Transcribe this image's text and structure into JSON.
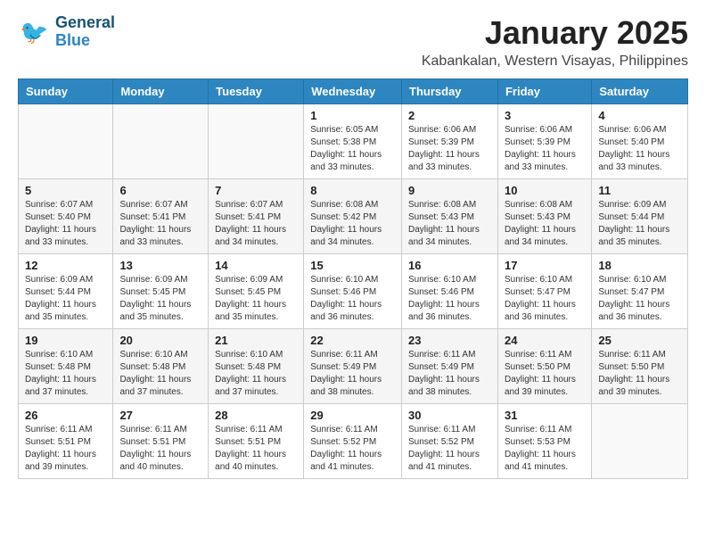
{
  "logo": {
    "general": "General",
    "blue": "Blue"
  },
  "title": "January 2025",
  "location": "Kabankalan, Western Visayas, Philippines",
  "days_header": [
    "Sunday",
    "Monday",
    "Tuesday",
    "Wednesday",
    "Thursday",
    "Friday",
    "Saturday"
  ],
  "weeks": [
    [
      {
        "day": "",
        "info": ""
      },
      {
        "day": "",
        "info": ""
      },
      {
        "day": "",
        "info": ""
      },
      {
        "day": "1",
        "info": "Sunrise: 6:05 AM\nSunset: 5:38 PM\nDaylight: 11 hours\nand 33 minutes."
      },
      {
        "day": "2",
        "info": "Sunrise: 6:06 AM\nSunset: 5:39 PM\nDaylight: 11 hours\nand 33 minutes."
      },
      {
        "day": "3",
        "info": "Sunrise: 6:06 AM\nSunset: 5:39 PM\nDaylight: 11 hours\nand 33 minutes."
      },
      {
        "day": "4",
        "info": "Sunrise: 6:06 AM\nSunset: 5:40 PM\nDaylight: 11 hours\nand 33 minutes."
      }
    ],
    [
      {
        "day": "5",
        "info": "Sunrise: 6:07 AM\nSunset: 5:40 PM\nDaylight: 11 hours\nand 33 minutes."
      },
      {
        "day": "6",
        "info": "Sunrise: 6:07 AM\nSunset: 5:41 PM\nDaylight: 11 hours\nand 33 minutes."
      },
      {
        "day": "7",
        "info": "Sunrise: 6:07 AM\nSunset: 5:41 PM\nDaylight: 11 hours\nand 34 minutes."
      },
      {
        "day": "8",
        "info": "Sunrise: 6:08 AM\nSunset: 5:42 PM\nDaylight: 11 hours\nand 34 minutes."
      },
      {
        "day": "9",
        "info": "Sunrise: 6:08 AM\nSunset: 5:43 PM\nDaylight: 11 hours\nand 34 minutes."
      },
      {
        "day": "10",
        "info": "Sunrise: 6:08 AM\nSunset: 5:43 PM\nDaylight: 11 hours\nand 34 minutes."
      },
      {
        "day": "11",
        "info": "Sunrise: 6:09 AM\nSunset: 5:44 PM\nDaylight: 11 hours\nand 35 minutes."
      }
    ],
    [
      {
        "day": "12",
        "info": "Sunrise: 6:09 AM\nSunset: 5:44 PM\nDaylight: 11 hours\nand 35 minutes."
      },
      {
        "day": "13",
        "info": "Sunrise: 6:09 AM\nSunset: 5:45 PM\nDaylight: 11 hours\nand 35 minutes."
      },
      {
        "day": "14",
        "info": "Sunrise: 6:09 AM\nSunset: 5:45 PM\nDaylight: 11 hours\nand 35 minutes."
      },
      {
        "day": "15",
        "info": "Sunrise: 6:10 AM\nSunset: 5:46 PM\nDaylight: 11 hours\nand 36 minutes."
      },
      {
        "day": "16",
        "info": "Sunrise: 6:10 AM\nSunset: 5:46 PM\nDaylight: 11 hours\nand 36 minutes."
      },
      {
        "day": "17",
        "info": "Sunrise: 6:10 AM\nSunset: 5:47 PM\nDaylight: 11 hours\nand 36 minutes."
      },
      {
        "day": "18",
        "info": "Sunrise: 6:10 AM\nSunset: 5:47 PM\nDaylight: 11 hours\nand 36 minutes."
      }
    ],
    [
      {
        "day": "19",
        "info": "Sunrise: 6:10 AM\nSunset: 5:48 PM\nDaylight: 11 hours\nand 37 minutes."
      },
      {
        "day": "20",
        "info": "Sunrise: 6:10 AM\nSunset: 5:48 PM\nDaylight: 11 hours\nand 37 minutes."
      },
      {
        "day": "21",
        "info": "Sunrise: 6:10 AM\nSunset: 5:48 PM\nDaylight: 11 hours\nand 37 minutes."
      },
      {
        "day": "22",
        "info": "Sunrise: 6:11 AM\nSunset: 5:49 PM\nDaylight: 11 hours\nand 38 minutes."
      },
      {
        "day": "23",
        "info": "Sunrise: 6:11 AM\nSunset: 5:49 PM\nDaylight: 11 hours\nand 38 minutes."
      },
      {
        "day": "24",
        "info": "Sunrise: 6:11 AM\nSunset: 5:50 PM\nDaylight: 11 hours\nand 39 minutes."
      },
      {
        "day": "25",
        "info": "Sunrise: 6:11 AM\nSunset: 5:50 PM\nDaylight: 11 hours\nand 39 minutes."
      }
    ],
    [
      {
        "day": "26",
        "info": "Sunrise: 6:11 AM\nSunset: 5:51 PM\nDaylight: 11 hours\nand 39 minutes."
      },
      {
        "day": "27",
        "info": "Sunrise: 6:11 AM\nSunset: 5:51 PM\nDaylight: 11 hours\nand 40 minutes."
      },
      {
        "day": "28",
        "info": "Sunrise: 6:11 AM\nSunset: 5:51 PM\nDaylight: 11 hours\nand 40 minutes."
      },
      {
        "day": "29",
        "info": "Sunrise: 6:11 AM\nSunset: 5:52 PM\nDaylight: 11 hours\nand 41 minutes."
      },
      {
        "day": "30",
        "info": "Sunrise: 6:11 AM\nSunset: 5:52 PM\nDaylight: 11 hours\nand 41 minutes."
      },
      {
        "day": "31",
        "info": "Sunrise: 6:11 AM\nSunset: 5:53 PM\nDaylight: 11 hours\nand 41 minutes."
      },
      {
        "day": "",
        "info": ""
      }
    ]
  ]
}
